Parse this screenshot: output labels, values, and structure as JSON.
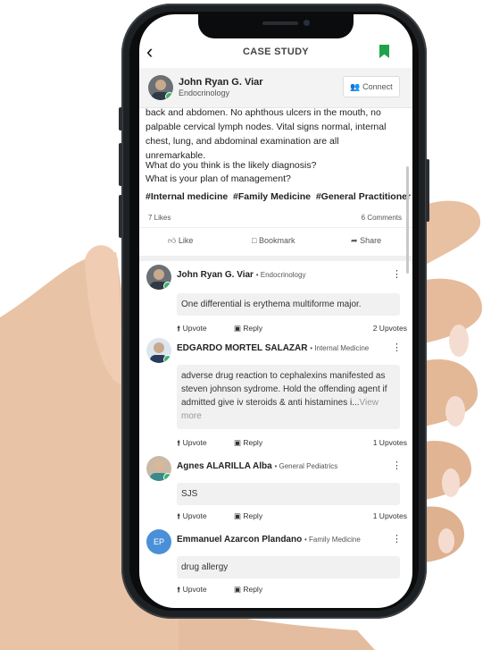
{
  "header": {
    "back_icon": "chevron-left-icon",
    "title": "CASE STUDY",
    "bookmark_icon": "bookmark-icon",
    "bookmark_color": "#1fa34a"
  },
  "author": {
    "name": "John Ryan G. Viar",
    "specialty": "Endocrinology",
    "connect_label": "Connect",
    "connect_icon": "add-user-icon"
  },
  "post": {
    "body_partial": "back and abdomen. No aphthous ulcers in the mouth, no palpable cervical lymph nodes. Vital signs normal, internal chest, lung, and abdominal examination are all unremarkable.",
    "question_1": "What do you think is the likely diagnosis?",
    "question_2": "What is your plan of management?",
    "tags": [
      "#Internal medicine",
      "#Family Medicine",
      "#General Practitioner"
    ],
    "likes": "7 Likes",
    "comments": "6 Comments",
    "actions": {
      "like": "Like",
      "bookmark": "Bookmark",
      "share": "Share"
    }
  },
  "comments": [
    {
      "name": "John Ryan G. Viar",
      "specialty": "• Endocrinology",
      "text": "One differential is erythema multiforme major.",
      "upvote": "Upvote",
      "reply": "Reply",
      "upvotes": "2 Upvotes"
    },
    {
      "name": "EDGARDO MORTEL SALAZAR",
      "specialty": "• Internal Medicine",
      "text": "adverse drug reaction to cephalexins  manifested as steven johnson sydrome. Hold the offending agent if admitted give iv steroids  & anti histamines i...",
      "view_more": "View more",
      "upvote": "Upvote",
      "reply": "Reply",
      "upvotes": "1 Upvotes"
    },
    {
      "name": "Agnes ALARILLA Alba",
      "specialty": "• General Pediatrics",
      "text": "SJS",
      "upvote": "Upvote",
      "reply": "Reply",
      "upvotes": "1 Upvotes"
    },
    {
      "name": "Emmanuel Azarcon Plandano",
      "specialty": "• Family Medicine",
      "initials": "EP",
      "text": "drug allergy",
      "upvote": "Upvote",
      "reply": "Reply"
    }
  ]
}
